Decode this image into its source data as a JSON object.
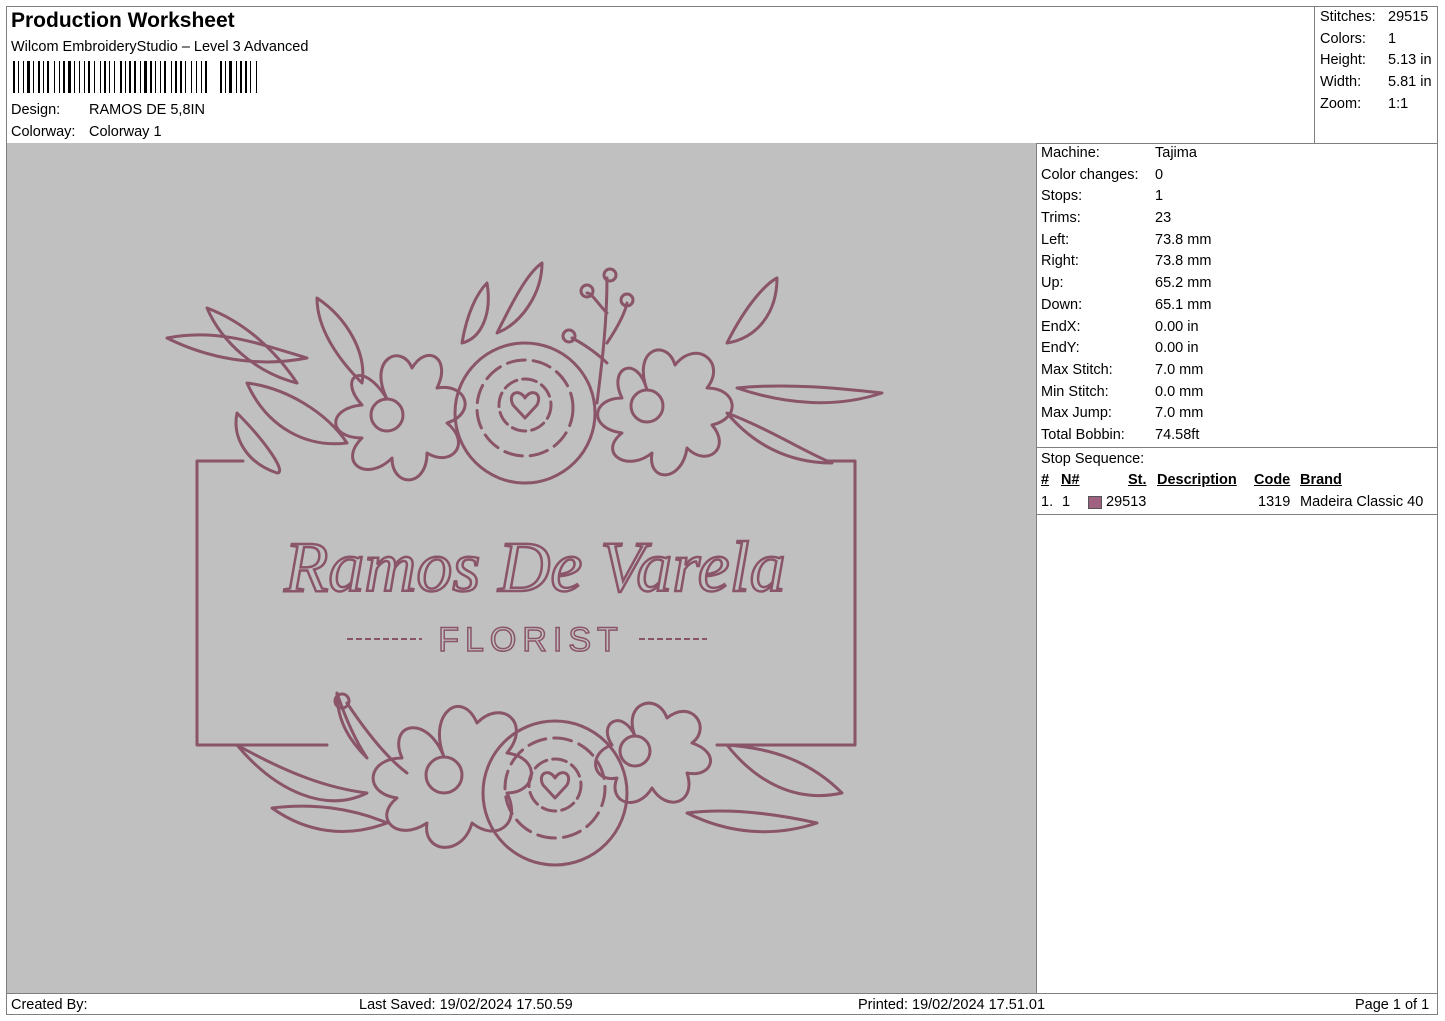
{
  "header": {
    "title": "Production Worksheet",
    "subtitle": "Wilcom EmbroideryStudio – Level 3 Advanced",
    "design_label": "Design:",
    "design_value": "RAMOS DE 5,8IN",
    "colorway_label": "Colorway:",
    "colorway_value": "Colorway 1"
  },
  "summary": {
    "stitches_label": "Stitches:",
    "stitches": "29515",
    "colors_label": "Colors:",
    "colors": "1",
    "height_label": "Height:",
    "height": "5.13 in",
    "width_label": "Width:",
    "width": "5.81 in",
    "zoom_label": "Zoom:",
    "zoom": "1:1"
  },
  "preview": {
    "brand_text": "Ramos De Varela",
    "sub_text": "FLORIST",
    "thread_color": "#8a5469",
    "background_color": "#c0c0c0"
  },
  "stats": [
    {
      "label": "Machine:",
      "value": "Tajima"
    },
    {
      "label": "Color changes:",
      "value": "0"
    },
    {
      "label": "Stops:",
      "value": "1"
    },
    {
      "label": "Trims:",
      "value": "23"
    },
    {
      "label": "Left:",
      "value": "73.8 mm"
    },
    {
      "label": "Right:",
      "value": "73.8 mm"
    },
    {
      "label": "Up:",
      "value": "65.2 mm"
    },
    {
      "label": "Down:",
      "value": "65.1 mm"
    },
    {
      "label": "EndX:",
      "value": "0.00 in"
    },
    {
      "label": "EndY:",
      "value": "0.00 in"
    },
    {
      "label": "Max Stitch:",
      "value": "7.0 mm"
    },
    {
      "label": "Min Stitch:",
      "value": "0.0 mm"
    },
    {
      "label": "Max Jump:",
      "value": "7.0 mm"
    },
    {
      "label": "Total Bobbin:",
      "value": "74.58ft"
    }
  ],
  "stop_sequence": {
    "label": "Stop Sequence:",
    "columns": {
      "num": "#",
      "n": "N#",
      "st": "St.",
      "description": "Description",
      "code": "Code",
      "brand": "Brand"
    },
    "rows": [
      {
        "num": "1.",
        "n": "1",
        "color": "#a0607f",
        "st": "29513",
        "description": "",
        "code": "1319",
        "brand": "Madeira Classic 40"
      }
    ]
  },
  "footer": {
    "created_by": "Created By:",
    "last_saved": "Last Saved: 19/02/2024 17.50.59",
    "printed": "Printed: 19/02/2024 17.51.01",
    "page": "Page 1 of 1"
  }
}
